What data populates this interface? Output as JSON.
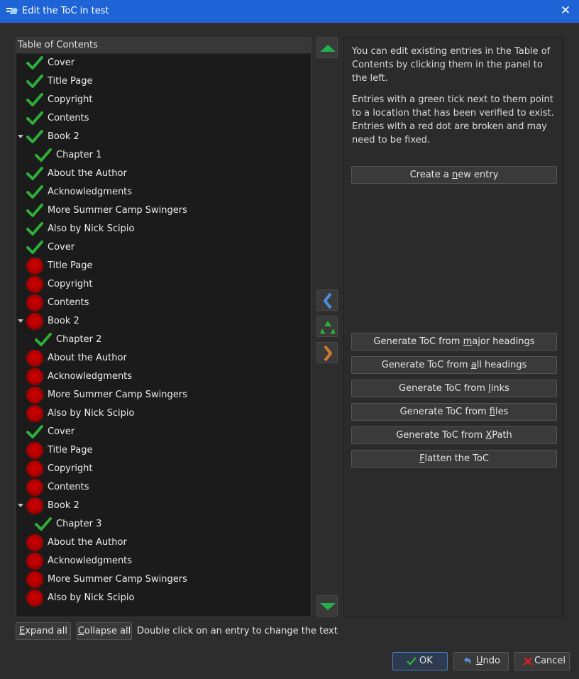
{
  "window": {
    "title": "Edit the ToC in test",
    "close_icon": "close-icon"
  },
  "tree": {
    "header": "Table of Contents",
    "rows": [
      {
        "label": "Cover",
        "status": "valid",
        "level": 0
      },
      {
        "label": "Title Page",
        "status": "valid",
        "level": 0
      },
      {
        "label": "Copyright",
        "status": "valid",
        "level": 0
      },
      {
        "label": "Contents",
        "status": "valid",
        "level": 0
      },
      {
        "label": "Book 2",
        "status": "valid",
        "level": 0,
        "expanded": true
      },
      {
        "label": "Chapter 1",
        "status": "valid",
        "level": 1
      },
      {
        "label": "About the Author",
        "status": "valid",
        "level": 0
      },
      {
        "label": "Acknowledgments",
        "status": "valid",
        "level": 0
      },
      {
        "label": "More Summer Camp Swingers",
        "status": "valid",
        "level": 0
      },
      {
        "label": "Also by Nick Scipio",
        "status": "valid",
        "level": 0
      },
      {
        "label": "Cover",
        "status": "valid",
        "level": 0
      },
      {
        "label": "Title Page",
        "status": "broken",
        "level": 0
      },
      {
        "label": "Copyright",
        "status": "broken",
        "level": 0
      },
      {
        "label": "Contents",
        "status": "broken",
        "level": 0
      },
      {
        "label": "Book 2",
        "status": "broken",
        "level": 0,
        "expanded": true
      },
      {
        "label": "Chapter 2",
        "status": "valid",
        "level": 1
      },
      {
        "label": "About the Author",
        "status": "broken",
        "level": 0
      },
      {
        "label": "Acknowledgments",
        "status": "broken",
        "level": 0
      },
      {
        "label": "More Summer Camp Swingers",
        "status": "broken",
        "level": 0
      },
      {
        "label": "Also by Nick Scipio",
        "status": "broken",
        "level": 0
      },
      {
        "label": "Cover",
        "status": "valid",
        "level": 0
      },
      {
        "label": "Title Page",
        "status": "broken",
        "level": 0
      },
      {
        "label": "Copyright",
        "status": "broken",
        "level": 0
      },
      {
        "label": "Contents",
        "status": "broken",
        "level": 0
      },
      {
        "label": "Book 2",
        "status": "broken",
        "level": 0,
        "expanded": true
      },
      {
        "label": "Chapter 3",
        "status": "valid",
        "level": 1
      },
      {
        "label": "About the Author",
        "status": "broken",
        "level": 0
      },
      {
        "label": "Acknowledgments",
        "status": "broken",
        "level": 0
      },
      {
        "label": "More Summer Camp Swingers",
        "status": "broken",
        "level": 0
      },
      {
        "label": "Also by Nick Scipio",
        "status": "broken",
        "level": 0
      }
    ]
  },
  "side_buttons": {
    "move_up_icon": "arrow-up-icon",
    "indent_left_icon": "chevron-left-icon",
    "delete_icon": "recycle-icon",
    "indent_right_icon": "chevron-right-icon",
    "move_down_icon": "arrow-down-icon"
  },
  "info": {
    "p1": "You can edit existing entries in the Table of Contents by clicking them in the panel to the left.",
    "p2": "Entries with a green tick next to them point to a location that has been verified to exist. Entries with a red dot are broken and may need to be fixed."
  },
  "actions": {
    "create": {
      "pre": "Create a ",
      "key": "n",
      "post": "ew entry"
    },
    "major": {
      "pre": "Generate ToC from ",
      "key": "m",
      "post": "ajor headings"
    },
    "all": {
      "pre": "Generate ToC from ",
      "key": "a",
      "post": "ll headings"
    },
    "links": {
      "pre": "Generate ToC from ",
      "key": "l",
      "post": "inks"
    },
    "files": {
      "pre": "Generate ToC from ",
      "key": "f",
      "post": "iles"
    },
    "xpath": {
      "pre": "Generate ToC from ",
      "key": "X",
      "post": "Path"
    },
    "flatten": {
      "pre": "",
      "key": "F",
      "post": "latten the ToC"
    }
  },
  "bottom": {
    "expand": {
      "key": "E",
      "post": "xpand all"
    },
    "collapse": {
      "key": "C",
      "post": "ollapse all"
    },
    "hint": "Double click on an entry to change the text"
  },
  "dialog": {
    "ok": "OK",
    "undo": {
      "key": "U",
      "post": "ndo"
    },
    "cancel": "Cancel"
  },
  "colors": {
    "titlebar": "#1f64d6",
    "tick": "#2fae3a",
    "broken": "#c00000",
    "accent": "#4a7fc8"
  }
}
